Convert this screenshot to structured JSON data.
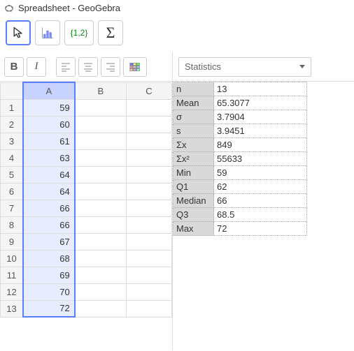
{
  "title": "Spreadsheet - GeoGebra",
  "toolbar": {
    "onetwo": "{1,2}",
    "sigma": "Σ"
  },
  "format": {
    "bold": "B",
    "italic": "I"
  },
  "columns": [
    "A",
    "B",
    "C"
  ],
  "rows": [
    {
      "n": "1",
      "A": "59"
    },
    {
      "n": "2",
      "A": "60"
    },
    {
      "n": "3",
      "A": "61"
    },
    {
      "n": "4",
      "A": "63"
    },
    {
      "n": "5",
      "A": "64"
    },
    {
      "n": "6",
      "A": "64"
    },
    {
      "n": "7",
      "A": "66"
    },
    {
      "n": "8",
      "A": "66"
    },
    {
      "n": "9",
      "A": "67"
    },
    {
      "n": "10",
      "A": "68"
    },
    {
      "n": "11",
      "A": "69"
    },
    {
      "n": "12",
      "A": "70"
    },
    {
      "n": "13",
      "A": "72"
    }
  ],
  "right_dropdown": "Statistics",
  "stats": [
    {
      "label": "n",
      "value": "13"
    },
    {
      "label": "Mean",
      "value": "65.3077"
    },
    {
      "label": "σ",
      "value": "3.7904"
    },
    {
      "label": "s",
      "value": "3.9451"
    },
    {
      "label": "Σx",
      "value": "849"
    },
    {
      "label": "Σx²",
      "value": "55633"
    },
    {
      "label": "Min",
      "value": "59"
    },
    {
      "label": "Q1",
      "value": "62"
    },
    {
      "label": "Median",
      "value": "66"
    },
    {
      "label": "Q3",
      "value": "68.5"
    },
    {
      "label": "Max",
      "value": "72"
    }
  ],
  "chart_data": {
    "type": "table",
    "title": "One-variable statistics",
    "series": [
      {
        "name": "A",
        "values": [
          59,
          60,
          61,
          63,
          64,
          64,
          66,
          66,
          67,
          68,
          69,
          70,
          72
        ]
      }
    ],
    "summary": {
      "n": 13,
      "Mean": 65.3077,
      "sigma": 3.7904,
      "s": 3.9451,
      "SumX": 849,
      "SumX2": 55633,
      "Min": 59,
      "Q1": 62,
      "Median": 66,
      "Q3": 68.5,
      "Max": 72
    }
  }
}
